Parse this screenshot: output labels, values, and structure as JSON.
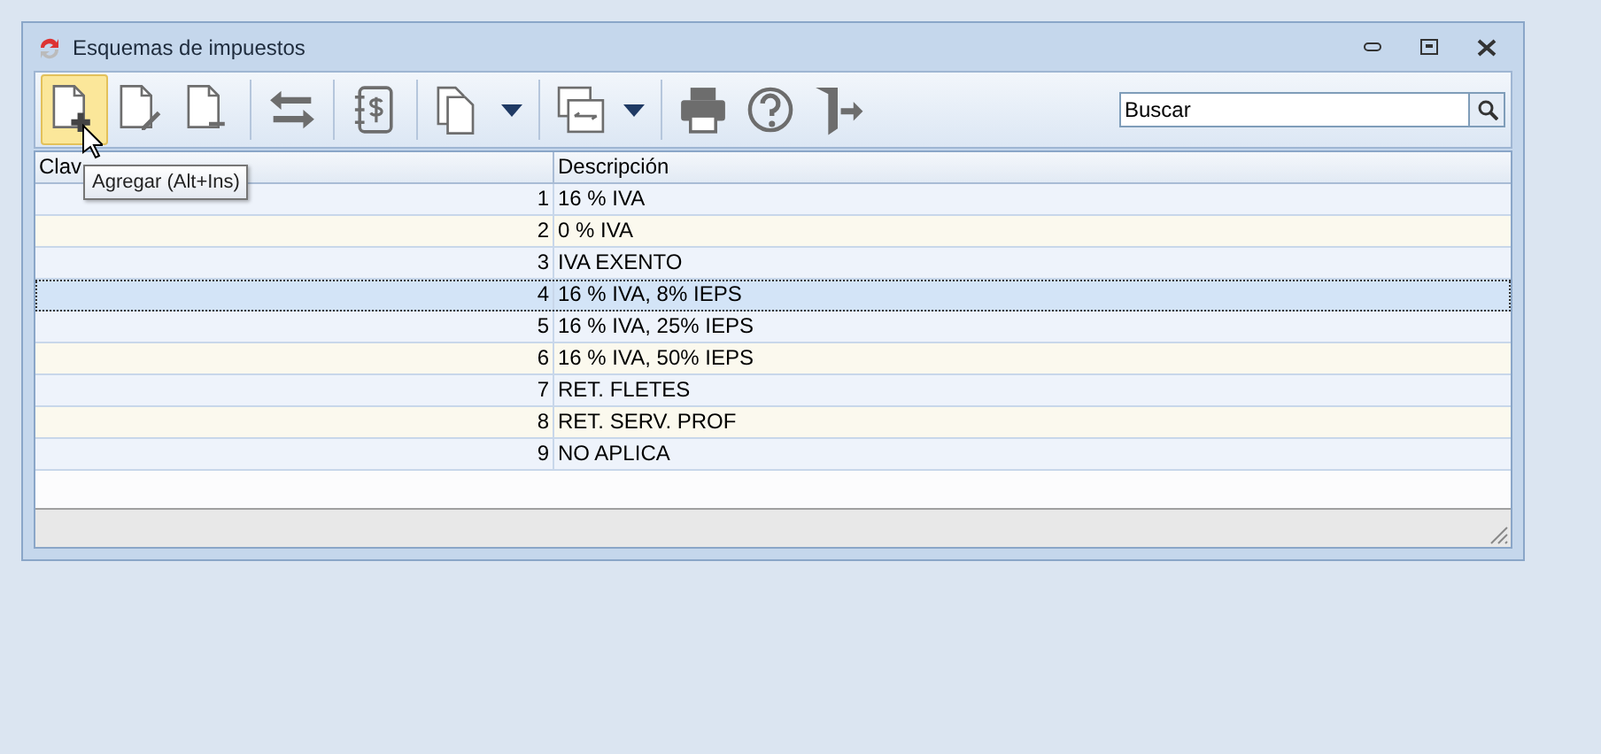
{
  "window": {
    "title": "Esquemas de impuestos"
  },
  "toolbar": {
    "buttons": [
      {
        "kind": "add",
        "highlighted": true
      },
      {
        "kind": "edit",
        "highlighted": false
      },
      {
        "kind": "delete",
        "highlighted": false
      },
      {
        "kind": "separator"
      },
      {
        "kind": "swap",
        "highlighted": false
      },
      {
        "kind": "separator"
      },
      {
        "kind": "money",
        "highlighted": false
      },
      {
        "kind": "separator"
      },
      {
        "kind": "copy",
        "highlighted": false,
        "dropdown": true
      },
      {
        "kind": "separator"
      },
      {
        "kind": "windows",
        "highlighted": false,
        "dropdown": true
      },
      {
        "kind": "separator"
      },
      {
        "kind": "print",
        "highlighted": false
      },
      {
        "kind": "help",
        "highlighted": false
      },
      {
        "kind": "exit",
        "highlighted": false
      }
    ],
    "search": {
      "value": "Buscar"
    }
  },
  "tooltip": "Agregar (Alt+Ins)",
  "table": {
    "columns": [
      "Clav",
      "Descripción"
    ],
    "rows": [
      {
        "clave": "1",
        "descripcion": "16 % IVA",
        "selected": false
      },
      {
        "clave": "2",
        "descripcion": "0 % IVA",
        "selected": false
      },
      {
        "clave": "3",
        "descripcion": "IVA EXENTO",
        "selected": false
      },
      {
        "clave": "4",
        "descripcion": "16 % IVA, 8% IEPS",
        "selected": true
      },
      {
        "clave": "5",
        "descripcion": "16 % IVA, 25% IEPS",
        "selected": false
      },
      {
        "clave": "6",
        "descripcion": "16 % IVA, 50% IEPS",
        "selected": false
      },
      {
        "clave": "7",
        "descripcion": "RET. FLETES",
        "selected": false
      },
      {
        "clave": "8",
        "descripcion": "RET. SERV. PROF",
        "selected": false
      },
      {
        "clave": "9",
        "descripcion": "NO APLICA",
        "selected": false
      }
    ]
  }
}
